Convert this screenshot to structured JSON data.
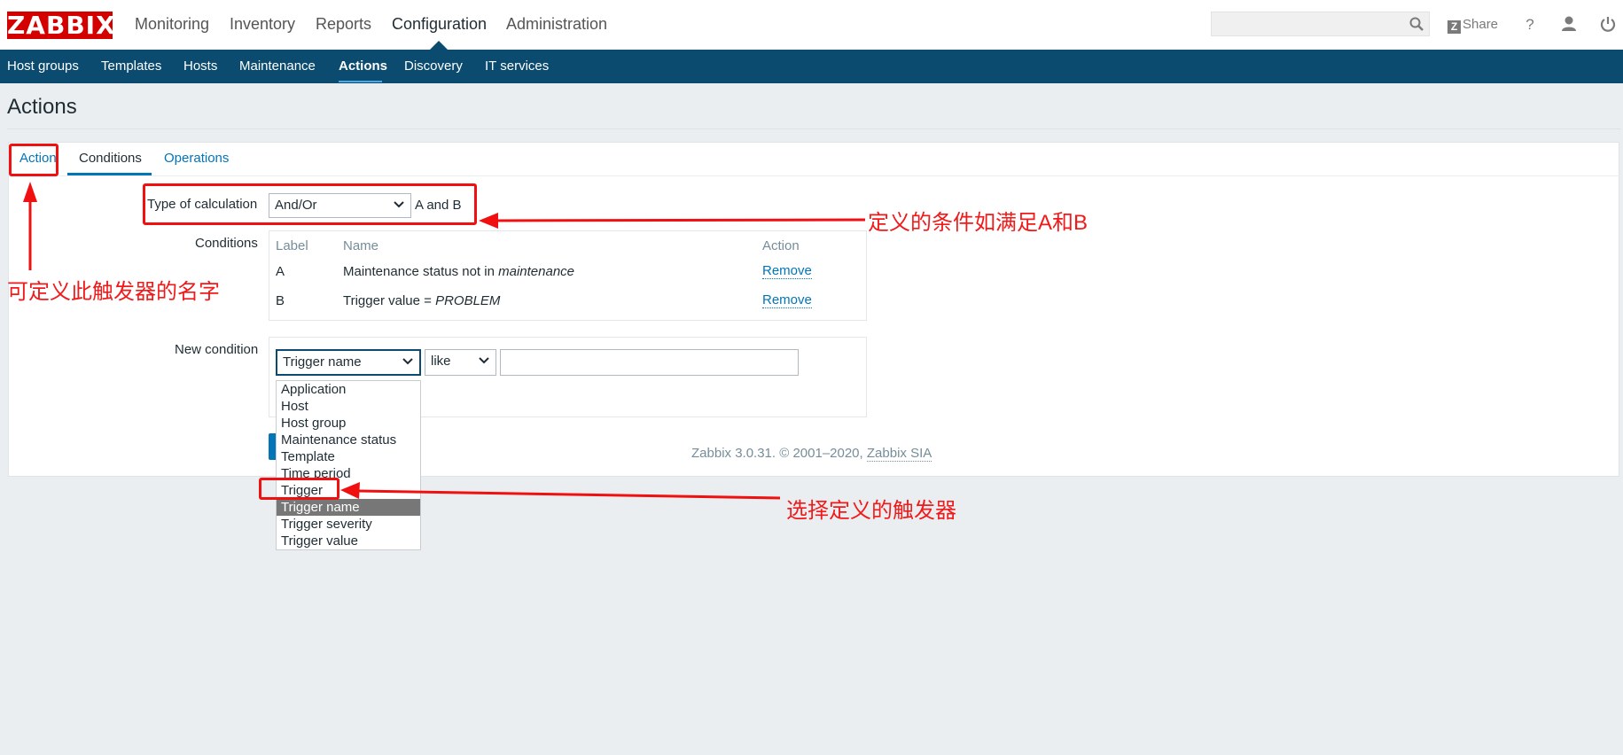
{
  "header": {
    "logo": "ZABBIX",
    "menu": [
      "Monitoring",
      "Inventory",
      "Reports",
      "Configuration",
      "Administration"
    ],
    "share_label": "Share",
    "search_value": ""
  },
  "submenu": [
    "Host groups",
    "Templates",
    "Hosts",
    "Maintenance",
    "Actions",
    "Discovery",
    "IT services"
  ],
  "page": {
    "title": "Actions"
  },
  "tabs": [
    "Action",
    "Conditions",
    "Operations"
  ],
  "form": {
    "calc_label": "Type of calculation",
    "calc_value": "And/Or",
    "calc_expression": "A and B",
    "conditions_label": "Conditions",
    "table_headers": [
      "Label",
      "Name",
      "Action"
    ],
    "rows": [
      {
        "label": "A",
        "name_prefix": "Maintenance status not in ",
        "name_value": "maintenance",
        "action": "Remove"
      },
      {
        "label": "B",
        "name_prefix": "Trigger value = ",
        "name_value": "PROBLEM",
        "action": "Remove"
      }
    ],
    "new_condition_label": "New condition",
    "condition_type": "Trigger name",
    "operator": "like",
    "value": "",
    "dropdown_options": [
      "Application",
      "Host",
      "Host group",
      "Maintenance status",
      "Template",
      "Time period",
      "Trigger",
      "Trigger name",
      "Trigger severity",
      "Trigger value"
    ],
    "dropdown_selected": "Trigger name"
  },
  "footer": {
    "text": "Zabbix 3.0.31. © 2001–2020, ",
    "link": "Zabbix SIA"
  },
  "annotations": {
    "calc_note": "定义的条件如满足A和B",
    "name_note": "可定义此触发器的名字",
    "trigger_note": "选择定义的触发器",
    "color": "#f01010"
  }
}
